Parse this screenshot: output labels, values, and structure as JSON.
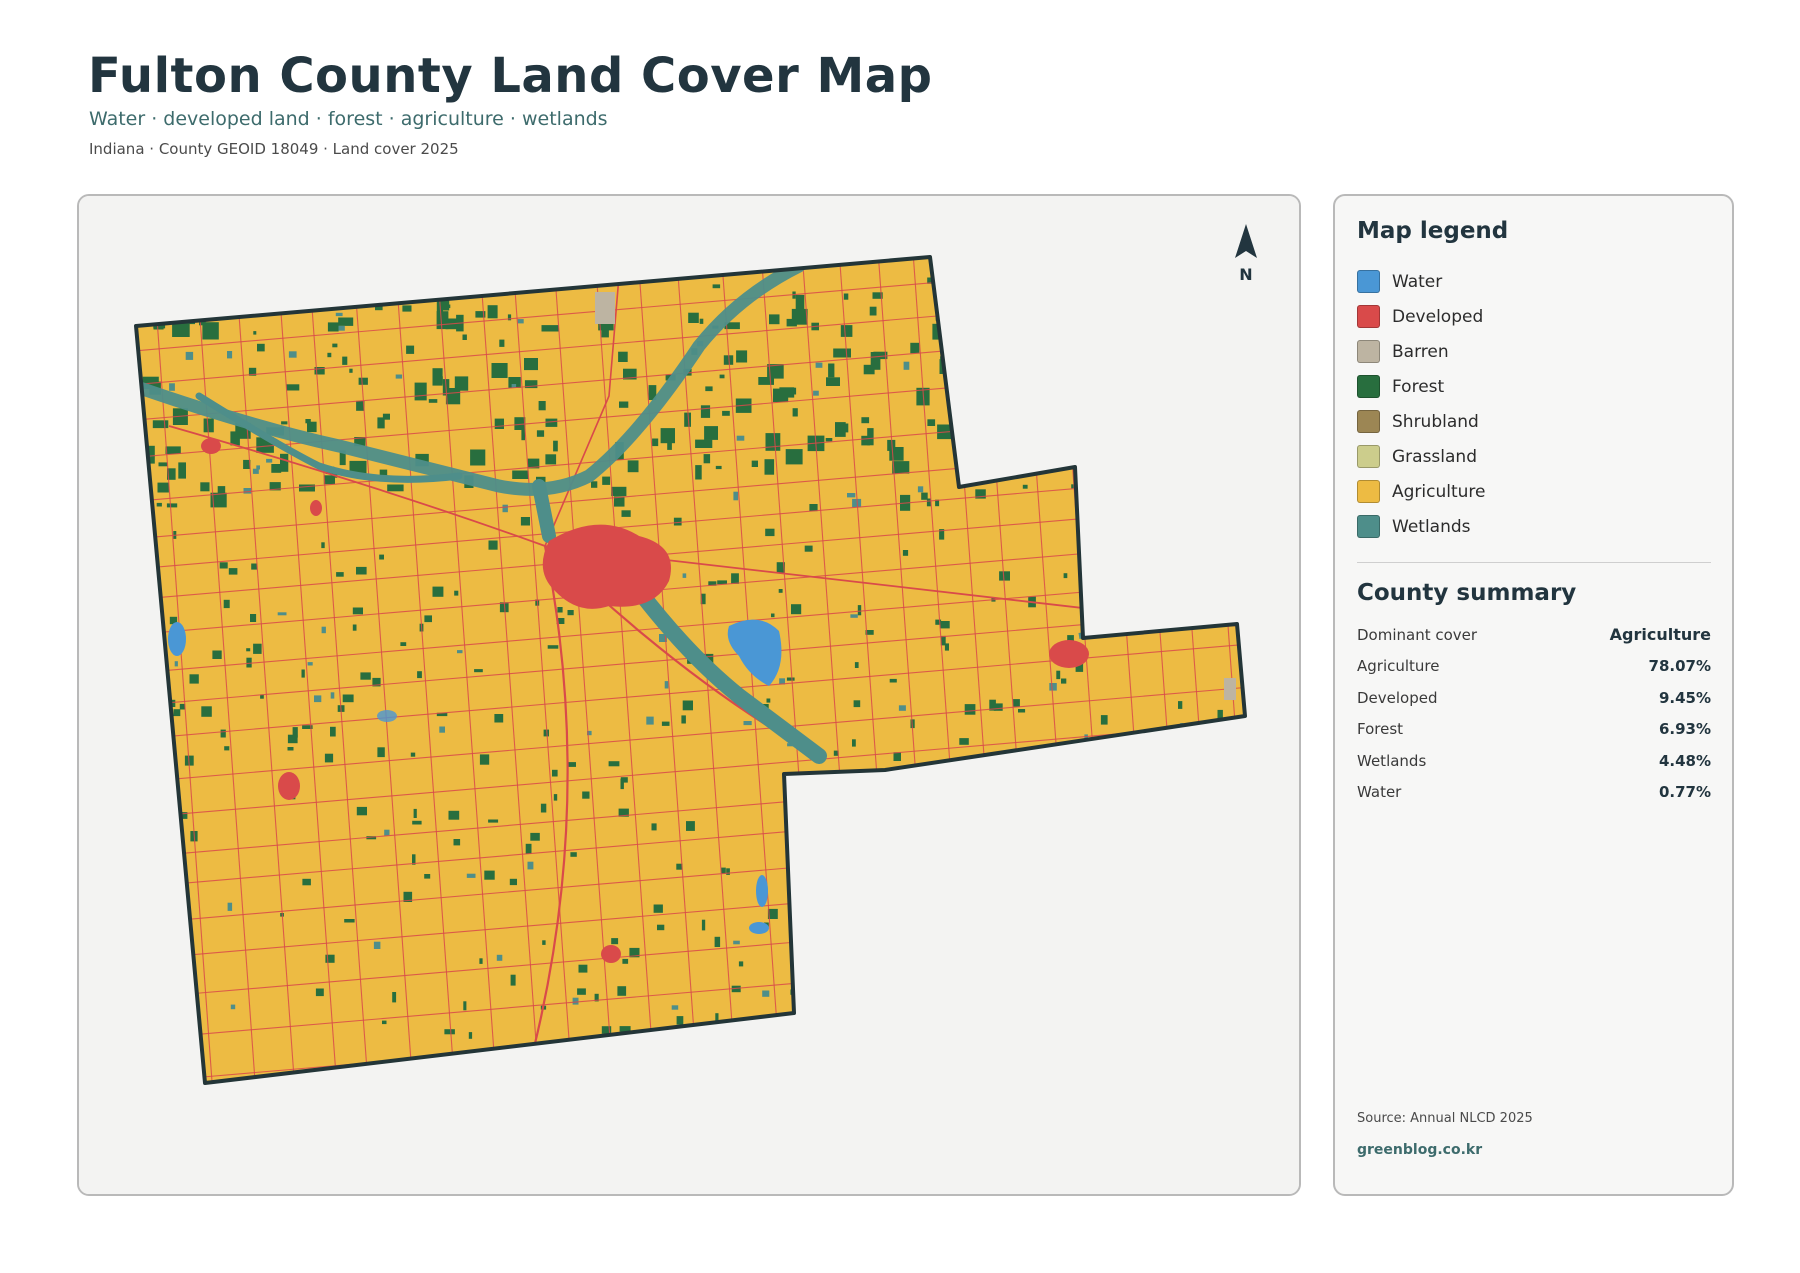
{
  "header": {
    "title": "Fulton County Land Cover Map",
    "subtitle": "Water · developed land · forest · agriculture · wetlands",
    "meta": "Indiana · County GEOID 18049 · Land cover 2025"
  },
  "map": {
    "north_label": "N",
    "colors": {
      "background": "#f3f3f2",
      "water": "#4a97d5",
      "developed": "#d94a4a",
      "barren": "#bdb4a2",
      "forest": "#286e3e",
      "agriculture": "#edbb43",
      "wetlands": "#4e8e8a",
      "border": "#233538"
    }
  },
  "legend": {
    "heading": "Map legend",
    "items": [
      {
        "label": "Water",
        "color": "#4a97d5"
      },
      {
        "label": "Developed",
        "color": "#d94a4a"
      },
      {
        "label": "Barren",
        "color": "#bdb4a2"
      },
      {
        "label": "Forest",
        "color": "#286e3e"
      },
      {
        "label": "Shrubland",
        "color": "#9c8654"
      },
      {
        "label": "Grassland",
        "color": "#cccd8c"
      },
      {
        "label": "Agriculture",
        "color": "#edbb43"
      },
      {
        "label": "Wetlands",
        "color": "#4e8e8a"
      }
    ]
  },
  "summary": {
    "heading": "County summary",
    "dominant_label": "Dominant cover",
    "dominant_value": "Agriculture",
    "rows": [
      {
        "label": "Agriculture",
        "value": "78.07%"
      },
      {
        "label": "Developed",
        "value": "9.45%"
      },
      {
        "label": "Forest",
        "value": "6.93%"
      },
      {
        "label": "Wetlands",
        "value": "4.48%"
      },
      {
        "label": "Water",
        "value": "0.77%"
      }
    ]
  },
  "footer": {
    "source": "Source: Annual NLCD 2025",
    "site": "greenblog.co.kr"
  }
}
